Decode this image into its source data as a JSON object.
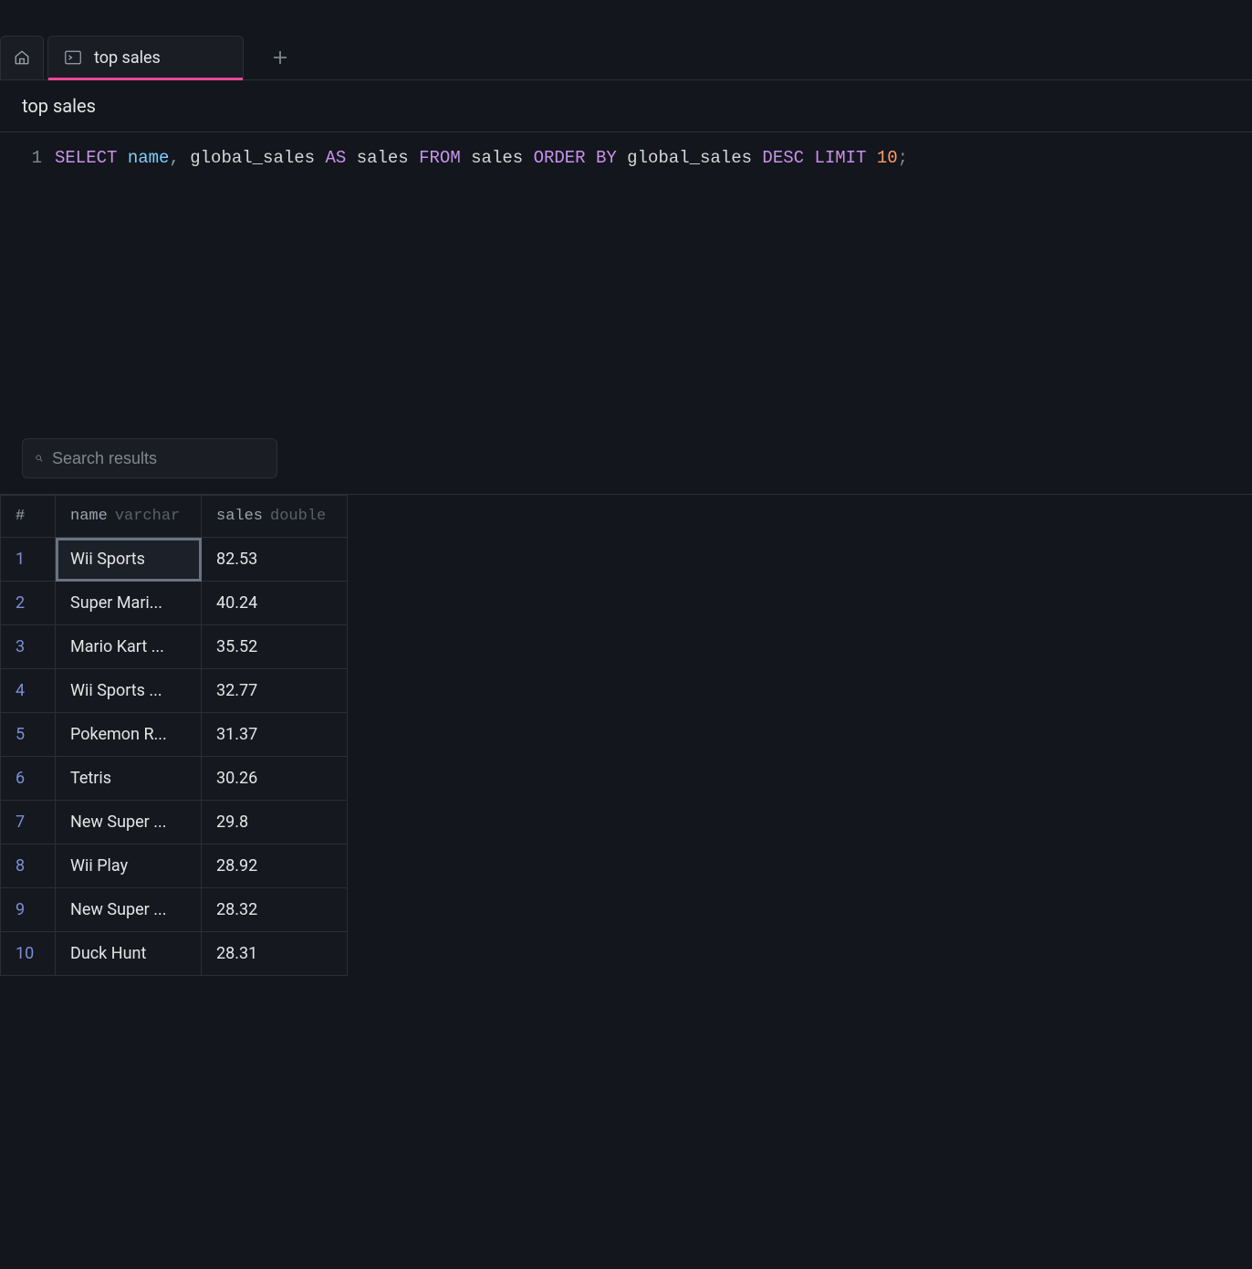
{
  "tabs": {
    "active_label": "top sales"
  },
  "title": "top sales",
  "editor": {
    "line_number": "1",
    "tokens": {
      "select": "SELECT",
      "name": "name",
      "comma": ",",
      "global_sales1": " global_sales ",
      "as": "AS",
      "sales": " sales ",
      "from": "FROM",
      "sales_tbl": " sales ",
      "order_by": "ORDER BY",
      "global_sales2": " global_sales ",
      "desc": "DESC",
      "space": " ",
      "limit": "LIMIT",
      "space2": " ",
      "ten": "10",
      "semi": ";"
    }
  },
  "search": {
    "placeholder": "Search results"
  },
  "columns": {
    "index": "#",
    "name": {
      "label": "name",
      "type": "varchar"
    },
    "sales": {
      "label": "sales",
      "type": "double"
    }
  },
  "rows": [
    {
      "idx": "1",
      "name": "Wii Sports",
      "sales": "82.53"
    },
    {
      "idx": "2",
      "name": "Super Mari...",
      "sales": "40.24"
    },
    {
      "idx": "3",
      "name": "Mario Kart ...",
      "sales": "35.52"
    },
    {
      "idx": "4",
      "name": "Wii Sports ...",
      "sales": "32.77"
    },
    {
      "idx": "5",
      "name": "Pokemon R...",
      "sales": "31.37"
    },
    {
      "idx": "6",
      "name": "Tetris",
      "sales": "30.26"
    },
    {
      "idx": "7",
      "name": "New Super ...",
      "sales": "29.8"
    },
    {
      "idx": "8",
      "name": "Wii Play",
      "sales": "28.92"
    },
    {
      "idx": "9",
      "name": "New Super ...",
      "sales": "28.32"
    },
    {
      "idx": "10",
      "name": "Duck Hunt",
      "sales": "28.31"
    }
  ]
}
